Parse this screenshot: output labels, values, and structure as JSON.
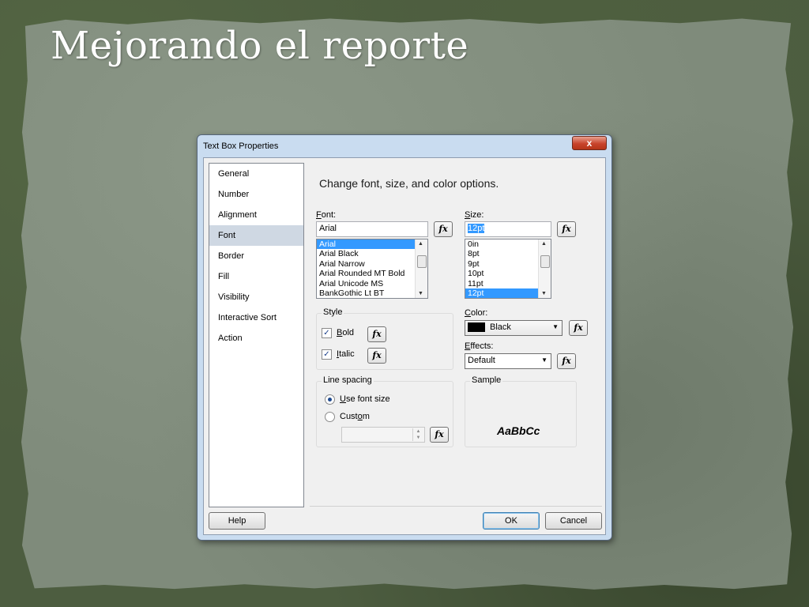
{
  "slide": {
    "title": "Mejorando el reporte"
  },
  "dialog": {
    "title": "Text Box Properties",
    "close_glyph": "x",
    "nav": [
      "General",
      "Number",
      "Alignment",
      "Font",
      "Border",
      "Fill",
      "Visibility",
      "Interactive Sort",
      "Action"
    ],
    "selected_nav": "Font",
    "heading": "Change font, size, and color options.",
    "font": {
      "label": "Font:",
      "value": "Arial",
      "options": [
        "Arial",
        "Arial Black",
        "Arial Narrow",
        "Arial Rounded MT Bold",
        "Arial Unicode MS",
        "BankGothic Lt BT"
      ],
      "selected": "Arial"
    },
    "size": {
      "label": "Size:",
      "value": "12pt",
      "options": [
        "0in",
        "8pt",
        "9pt",
        "10pt",
        "11pt",
        "12pt"
      ],
      "selected": "12pt"
    },
    "style": {
      "group_label": "Style",
      "bold_label": "Bold",
      "bold_checked": true,
      "italic_label": "Italic",
      "italic_checked": true
    },
    "color": {
      "label": "Color:",
      "value": "Black",
      "swatch": "#000000"
    },
    "effects": {
      "label": "Effects:",
      "value": "Default"
    },
    "line_spacing": {
      "group_label": "Line spacing",
      "use_font_size_label": "Use font size",
      "custom_label": "Custom",
      "selected": "use_font_size",
      "custom_value": ""
    },
    "sample": {
      "group_label": "Sample",
      "text": "AaBbCc"
    },
    "fx_label": "fx",
    "buttons": {
      "help": "Help",
      "ok": "OK",
      "cancel": "Cancel"
    }
  }
}
